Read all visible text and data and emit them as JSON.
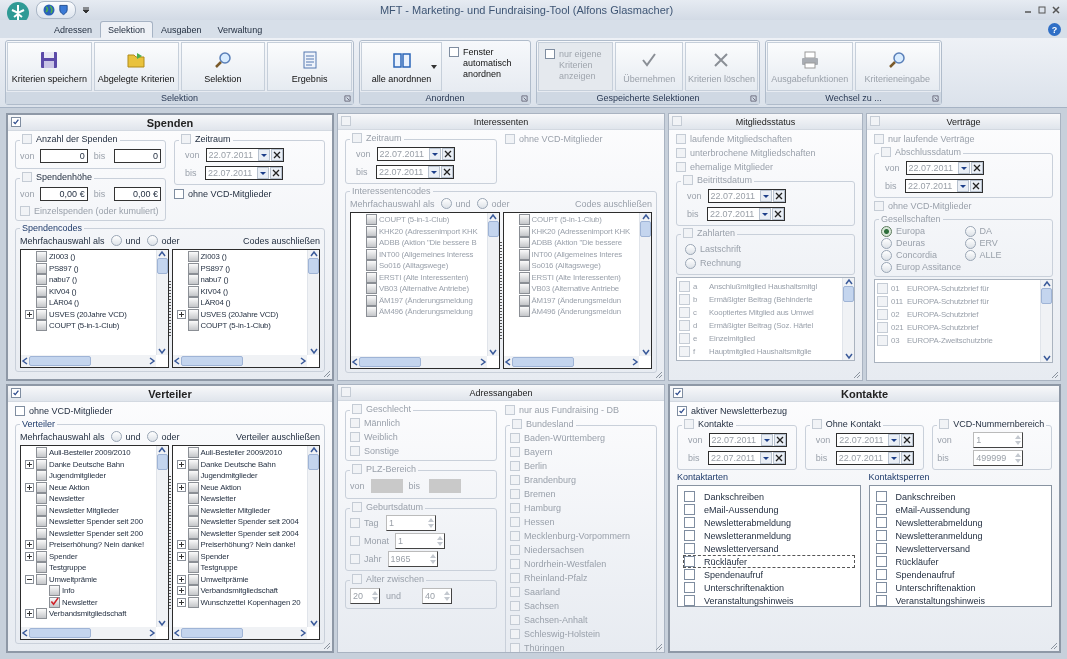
{
  "window": {
    "title": "MFT -  Marketing- und Fundraising-Tool (Alfons Glasmacher)"
  },
  "ribbon": {
    "help": "?",
    "tabs": [
      {
        "label": "Adressen",
        "selected": false
      },
      {
        "label": "Selektion",
        "selected": true
      },
      {
        "label": "Ausgaben",
        "selected": false
      },
      {
        "label": "Verwaltung",
        "selected": false
      }
    ],
    "groups": [
      {
        "title": "Selektion",
        "items": [
          {
            "kind": "button",
            "label": "Kriterien speichern",
            "disabled": false
          },
          {
            "kind": "button",
            "label": "Abgelegte Kriterien",
            "disabled": false
          },
          {
            "kind": "button",
            "label": "Selektion",
            "disabled": false
          },
          {
            "kind": "button",
            "label": "Ergebnis",
            "disabled": false
          }
        ]
      },
      {
        "title": "Anordnen",
        "items": [
          {
            "kind": "button",
            "label": "alle anordnnen",
            "disabled": false,
            "dropdown": true
          },
          {
            "kind": "check",
            "label": "Fenster automatisch anordnen",
            "checked": false,
            "disabled": false
          }
        ]
      },
      {
        "title": "Gespeicherte Selektionen",
        "items": [
          {
            "kind": "check",
            "label": "nur eigene Kriterien anzeigen",
            "checked": false,
            "disabled": true
          },
          {
            "kind": "button",
            "label": "Übernehmen",
            "disabled": true
          },
          {
            "kind": "button",
            "label": "Kriterien löschen",
            "disabled": true
          }
        ]
      },
      {
        "title": "Wechsel zu ...",
        "items": [
          {
            "kind": "button",
            "label": "Ausgabefunktionen",
            "disabled": true
          },
          {
            "kind": "button",
            "label": "Kriterieneingabe",
            "disabled": true
          }
        ]
      }
    ]
  },
  "panels": [
    {
      "title": "Spenden",
      "checked": true,
      "body": [
        {
          "kind": "row",
          "children": [
            {
              "kind": "col",
              "children": [
                {
                  "kind": "group",
                  "title": "Anzahl der Spenden",
                  "checked": false,
                  "children": [
                    {
                      "kind": "fields",
                      "items": [
                        {
                          "label": "von",
                          "value": "0"
                        },
                        {
                          "label": "bis",
                          "value": "0"
                        }
                      ]
                    }
                  ]
                },
                {
                  "kind": "group",
                  "title": "Spendenhöhe",
                  "checked": false,
                  "children": [
                    {
                      "kind": "fields",
                      "items": [
                        {
                          "label": "von",
                          "value": "0,00 €"
                        },
                        {
                          "label": "bis",
                          "value": "0,00 €"
                        }
                      ]
                    },
                    {
                      "kind": "check",
                      "label": "Einzelspenden (oder kumuliert)",
                      "checked": false
                    }
                  ]
                }
              ]
            },
            {
              "kind": "col",
              "children": [
                {
                  "kind": "group",
                  "title": "Zeitraum",
                  "checked": false,
                  "children": [
                    {
                      "kind": "date",
                      "label": "von",
                      "value": "22.07.2011"
                    },
                    {
                      "kind": "date",
                      "label": "bis",
                      "value": "22.07.2011"
                    }
                  ]
                },
                {
                  "kind": "check",
                  "label": "ohne VCD-Mitglieder",
                  "checked": false
                }
              ]
            }
          ]
        },
        {
          "kind": "group",
          "title": "Spendencodes",
          "children": [
            {
              "kind": "choice",
              "label": "Mehrfachauswahl als",
              "options": [
                {
                  "label": "und",
                  "selected": false
                },
                {
                  "label": "oder",
                  "selected": false
                }
              ],
              "note": "Codes auschließen"
            },
            {
              "kind": "trees",
              "trees": [
                [
                  {
                    "label": "ZI003 ()",
                    "checked": false
                  },
                  {
                    "label": "PS897 ()",
                    "checked": false
                  },
                  {
                    "label": "nabu7 ()",
                    "checked": false
                  },
                  {
                    "label": "KIV04 ()",
                    "checked": false
                  },
                  {
                    "label": "LÄR04 ()",
                    "checked": false
                  },
                  {
                    "label": "USVES (20Jahre VCD)",
                    "checked": false,
                    "expanded": false
                  },
                  {
                    "label": "COUPT (5-in-1-Club)",
                    "checked": false
                  }
                ],
                [
                  {
                    "label": "ZI003 ()",
                    "checked": false
                  },
                  {
                    "label": "PS897 ()",
                    "checked": false
                  },
                  {
                    "label": "nabu7 ()",
                    "checked": false
                  },
                  {
                    "label": "KIV04 ()",
                    "checked": false
                  },
                  {
                    "label": "LÄR04 ()",
                    "checked": false
                  },
                  {
                    "label": "USVES (20Jahre VCD)",
                    "checked": false,
                    "expanded": false
                  },
                  {
                    "label": "COUPT (5-in-1-Club)",
                    "checked": false
                  }
                ]
              ]
            }
          ]
        }
      ]
    },
    {
      "title": "Interessenten",
      "checked": false,
      "body": [
        {
          "kind": "row",
          "children": [
            {
              "kind": "col",
              "children": [
                {
                  "kind": "group",
                  "title": "Zeitraum",
                  "checked": false,
                  "children": [
                    {
                      "kind": "date",
                      "label": "von",
                      "value": "22.07.2011"
                    },
                    {
                      "kind": "date",
                      "label": "bis",
                      "value": "22.07.2011"
                    }
                  ]
                }
              ]
            },
            {
              "kind": "col",
              "children": [
                {
                  "kind": "check",
                  "label": "ohne VCD-Mitglieder",
                  "checked": false
                }
              ]
            }
          ]
        },
        {
          "kind": "group",
          "title": "Interessentencodes",
          "children": [
            {
              "kind": "choice",
              "label": "Mehrfachauswahl als",
              "options": [
                {
                  "label": "und",
                  "selected": false
                },
                {
                  "label": "oder",
                  "selected": false
                }
              ],
              "note": "Codes auschließen"
            },
            {
              "kind": "trees",
              "trees": [
                [
                  {
                    "label": "COUPT (5-in-1-Club)",
                    "checked": false
                  },
                  {
                    "label": "KHK20 (Adressenimport KHK",
                    "checked": false
                  },
                  {
                    "label": "ADBB (Aktion \"Die bessere B",
                    "checked": false
                  },
                  {
                    "label": "INT00 (Allgemeines Interess",
                    "checked": false
                  },
                  {
                    "label": "So016 (Alltagswege)",
                    "checked": false
                  },
                  {
                    "label": "ERSTI (Alte Interessenten)",
                    "checked": false
                  },
                  {
                    "label": "VB03 (Alternative Antriebe)",
                    "checked": false
                  },
                  {
                    "label": "ÄM197 (Änderungsmeldung",
                    "checked": false
                  },
                  {
                    "label": "ÄM496 (Änderungsmeldung",
                    "checked": false
                  }
                ],
                [
                  {
                    "label": "COUPT (5-in-1-Club)",
                    "checked": false
                  },
                  {
                    "label": "KHK20 (Adressenimport KHK",
                    "checked": false
                  },
                  {
                    "label": "ADBB (Aktion \"Die bessere",
                    "checked": false
                  },
                  {
                    "label": "INT00 (Allgemeines Interes",
                    "checked": false
                  },
                  {
                    "label": "So016 (Alltagswege)",
                    "checked": false
                  },
                  {
                    "label": "ERSTI (Alte Interessenten)",
                    "checked": false
                  },
                  {
                    "label": "VB03 (Alternative Antriebe",
                    "checked": false
                  },
                  {
                    "label": "ÄM197 (Änderungsmeldun",
                    "checked": false
                  },
                  {
                    "label": "ÄM496 (Änderungsmeldun",
                    "checked": false
                  }
                ]
              ]
            }
          ]
        }
      ]
    },
    {
      "title": "Mitgliedsstatus",
      "checked": false,
      "body": [
        {
          "kind": "check",
          "label": "laufende Mitgliedschaften",
          "checked": false
        },
        {
          "kind": "check",
          "label": "unterbrochene Mitgliedschaften",
          "checked": false
        },
        {
          "kind": "check",
          "label": "ehemalige Mitglieder",
          "checked": false
        },
        {
          "kind": "group",
          "title": "Beitrittsdatum",
          "checked": false,
          "children": [
            {
              "kind": "date",
              "label": "von",
              "value": "22.07.2011"
            },
            {
              "kind": "date",
              "label": "bis",
              "value": "22.07.2011"
            }
          ]
        },
        {
          "kind": "group",
          "title": "Zahlarten",
          "checked": false,
          "children": [
            {
              "kind": "radiolist",
              "options": [
                {
                  "label": "Lastschrift",
                  "selected": false
                },
                {
                  "label": "Rechnung",
                  "selected": false
                }
              ]
            }
          ]
        },
        {
          "kind": "codelist",
          "rows": [
            {
              "code": "a",
              "text": "Anschlußmitglied Haushaltsmitgl",
              "checked": false
            },
            {
              "code": "b",
              "text": "Ermäßigter Beitrag (Behinderte",
              "checked": false
            },
            {
              "code": "c",
              "text": "Kooptiertes Mitglied aus Umwel",
              "checked": false
            },
            {
              "code": "d",
              "text": "Ermäßigter Beitrag (Soz. Härtel",
              "checked": false
            },
            {
              "code": "e",
              "text": "Einzelmitglied",
              "checked": false
            },
            {
              "code": "f",
              "text": "Hauptmitglied Haushaltsmitglie",
              "checked": false
            }
          ]
        }
      ]
    },
    {
      "title": "Verträge",
      "checked": false,
      "body": [
        {
          "kind": "check",
          "label": "nur laufende Verträge",
          "checked": false
        },
        {
          "kind": "group",
          "title": "Abschlussdatum",
          "checked": false,
          "children": [
            {
              "kind": "date",
              "label": "von",
              "value": "22.07.2011"
            },
            {
              "kind": "date",
              "label": "bis",
              "value": "22.07.2011"
            }
          ]
        },
        {
          "kind": "check",
          "label": "ohne VCD-Mitglieder",
          "checked": false
        },
        {
          "kind": "group",
          "title": "Gesellschaften",
          "children": [
            {
              "kind": "radiogrid",
              "options": [
                {
                  "label": "Europa",
                  "selected": true
                },
                {
                  "label": "DA",
                  "selected": false
                },
                {
                  "label": "Deuras",
                  "selected": false
                },
                {
                  "label": "ERV",
                  "selected": false
                },
                {
                  "label": "Concordia",
                  "selected": false
                },
                {
                  "label": "ALLE",
                  "selected": false
                },
                {
                  "label": "Europ Assitance",
                  "selected": false
                }
              ]
            }
          ]
        },
        {
          "kind": "codelist",
          "rows": [
            {
              "code": "01",
              "text": "EUROPA-Schutzbrief für",
              "checked": false
            },
            {
              "code": "011",
              "text": "EUROPA-Schutzbrief für",
              "checked": false
            },
            {
              "code": "02",
              "text": "EUROPA-Schutzbrief",
              "checked": false
            },
            {
              "code": "021",
              "text": "EUROPA-Schutzbrief",
              "checked": false
            },
            {
              "code": "03",
              "text": "EUROPA-Zweitschutzbrie",
              "checked": false
            }
          ]
        }
      ]
    },
    {
      "title": "Verteiler",
      "checked": true,
      "body": [
        {
          "kind": "check",
          "label": "ohne VCD-Mitglieder",
          "checked": false
        },
        {
          "kind": "group",
          "title": "Verteiler",
          "children": [
            {
              "kind": "choice",
              "label": "Mehrfachauswahl als",
              "options": [
                {
                  "label": "und",
                  "selected": false
                },
                {
                  "label": "oder",
                  "selected": false
                }
              ],
              "note": "Verteiler auschließen"
            },
            {
              "kind": "trees",
              "trees": [
                [
                  {
                    "label": "Auli-Besteller 2009/2010",
                    "checked": false
                  },
                  {
                    "label": "Danke Deutsche Bahn",
                    "checked": false,
                    "expanded": false
                  },
                  {
                    "label": "Jugendmitglieder",
                    "checked": false
                  },
                  {
                    "label": "Neue Aktion",
                    "checked": false,
                    "expanded": false
                  },
                  {
                    "label": "Newsletter",
                    "checked": false
                  },
                  {
                    "label": "Newsletter Mitglieder",
                    "checked": false
                  },
                  {
                    "label": "Newsletter Spender seit 200",
                    "checked": false
                  },
                  {
                    "label": "Newsletter Spender seit 200",
                    "checked": false
                  },
                  {
                    "label": "Preiserhöhung? Nein danke!",
                    "checked": false,
                    "expanded": false
                  },
                  {
                    "label": "Spender",
                    "checked": false,
                    "expanded": false
                  },
                  {
                    "label": "Testgruppe",
                    "checked": false
                  },
                  {
                    "label": "Umweltprämie",
                    "checked": false,
                    "expanded": true,
                    "children": [
                      {
                        "label": "Info",
                        "checked": false
                      },
                      {
                        "label": "Newsletter",
                        "checked": true
                      }
                    ]
                  },
                  {
                    "label": "Verbandsmitgliedschaft",
                    "checked": false,
                    "expanded": false
                  }
                ],
                [
                  {
                    "label": "Auli-Besteller 2009/2010",
                    "checked": false
                  },
                  {
                    "label": "Danke Deutsche Bahn",
                    "checked": false,
                    "expanded": false
                  },
                  {
                    "label": "Jugendmitglieder",
                    "checked": false
                  },
                  {
                    "label": "Neue Aktion",
                    "checked": false,
                    "expanded": false
                  },
                  {
                    "label": "Newsletter",
                    "checked": false
                  },
                  {
                    "label": "Newsletter Mitglieder",
                    "checked": false
                  },
                  {
                    "label": "Newsletter Spender seit 2004",
                    "checked": false
                  },
                  {
                    "label": "Newsletter Spender seit 2004",
                    "checked": false
                  },
                  {
                    "label": "Preiserhöhung? Nein danke!",
                    "checked": false,
                    "expanded": false
                  },
                  {
                    "label": "Spender",
                    "checked": false,
                    "expanded": false
                  },
                  {
                    "label": "Testgruppe",
                    "checked": false
                  },
                  {
                    "label": "Umweltprämie",
                    "checked": false,
                    "expanded": false
                  },
                  {
                    "label": "Verbandsmitgliedschaft",
                    "checked": false,
                    "expanded": false
                  },
                  {
                    "label": "Wunschzettel Kopenhagen 20",
                    "checked": false,
                    "expanded": false
                  }
                ]
              ]
            }
          ]
        }
      ]
    },
    {
      "title": "Adressangaben",
      "checked": false,
      "body": [
        {
          "kind": "row",
          "children": [
            {
              "kind": "col",
              "children": [
                {
                  "kind": "group",
                  "title": "Geschlecht",
                  "checked": false,
                  "children": [
                    {
                      "kind": "check",
                      "label": "Männlich",
                      "checked": false
                    },
                    {
                      "kind": "check",
                      "label": "Weiblich",
                      "checked": false
                    },
                    {
                      "kind": "check",
                      "label": "Sonstige",
                      "checked": false
                    }
                  ]
                },
                {
                  "kind": "group",
                  "title": "PLZ-Bereich",
                  "checked": false,
                  "children": [
                    {
                      "kind": "fields",
                      "items": [
                        {
                          "label": "von"
                        },
                        {
                          "label": "bis"
                        }
                      ]
                    }
                  ]
                },
                {
                  "kind": "group",
                  "title": "Geburtsdatum",
                  "checked": false,
                  "children": [
                    {
                      "kind": "spins",
                      "items": [
                        {
                          "label": "Tag",
                          "checked": false,
                          "value": "1"
                        },
                        {
                          "label": "Monat",
                          "checked": false,
                          "value": "1"
                        },
                        {
                          "label": "Jahr",
                          "checked": false,
                          "value": "1965"
                        }
                      ]
                    }
                  ]
                },
                {
                  "kind": "group",
                  "title": "Alter zwischen",
                  "checked": false,
                  "children": [
                    {
                      "kind": "spinline",
                      "items": [
                        {
                          "value": "20"
                        },
                        {
                          "label": "und",
                          "value": "40"
                        }
                      ]
                    }
                  ]
                }
              ]
            },
            {
              "kind": "col",
              "children": [
                {
                  "kind": "check",
                  "label": "nur aus Fundraising - DB",
                  "checked": false
                },
                {
                  "kind": "group",
                  "title": "Bundesland",
                  "checked": false,
                  "children": [
                    {
                      "kind": "check",
                      "label": "Baden-Württemberg",
                      "checked": false
                    },
                    {
                      "kind": "check",
                      "label": "Bayern",
                      "checked": false
                    },
                    {
                      "kind": "check",
                      "label": "Berlin",
                      "checked": false
                    },
                    {
                      "kind": "check",
                      "label": "Brandenburg",
                      "checked": false
                    },
                    {
                      "kind": "check",
                      "label": "Bremen",
                      "checked": false
                    },
                    {
                      "kind": "check",
                      "label": "Hamburg",
                      "checked": false
                    },
                    {
                      "kind": "check",
                      "label": "Hessen",
                      "checked": false
                    },
                    {
                      "kind": "check",
                      "label": "Mecklenburg-Vorpommern",
                      "checked": false
                    },
                    {
                      "kind": "check",
                      "label": "Niedersachsen",
                      "checked": false
                    },
                    {
                      "kind": "check",
                      "label": "Nordrhein-Westfalen",
                      "checked": false
                    },
                    {
                      "kind": "check",
                      "label": "Rheinland-Pfalz",
                      "checked": false
                    },
                    {
                      "kind": "check",
                      "label": "Saarland",
                      "checked": false
                    },
                    {
                      "kind": "check",
                      "label": "Sachsen",
                      "checked": false
                    },
                    {
                      "kind": "check",
                      "label": "Sachsen-Anhalt",
                      "checked": false
                    },
                    {
                      "kind": "check",
                      "label": "Schleswig-Holstein",
                      "checked": false
                    },
                    {
                      "kind": "check",
                      "label": "Thüringen",
                      "checked": false
                    }
                  ]
                }
              ]
            }
          ]
        }
      ]
    },
    {
      "title": "Kontakte",
      "checked": true,
      "body": [
        {
          "kind": "check",
          "label": "aktiver Newsletterbezug",
          "checked": true
        },
        {
          "kind": "row",
          "children": [
            {
              "kind": "col",
              "children": [
                {
                  "kind": "group",
                  "title": "Kontakte",
                  "checked": false,
                  "children": [
                    {
                      "kind": "date",
                      "label": "von",
                      "value": "22.07.2011"
                    },
                    {
                      "kind": "date",
                      "label": "bis",
                      "value": "22.07.2011"
                    }
                  ]
                }
              ]
            },
            {
              "kind": "col",
              "children": [
                {
                  "kind": "group",
                  "title": "Ohne Kontakt",
                  "checked": false,
                  "children": [
                    {
                      "kind": "date",
                      "label": "von",
                      "value": "22.07.2011"
                    },
                    {
                      "kind": "date",
                      "label": "bis",
                      "value": "22.07.2011"
                    }
                  ]
                }
              ]
            },
            {
              "kind": "col",
              "children": [
                {
                  "kind": "group",
                  "title": "VCD-Nummernbereich",
                  "checked": false,
                  "children": [
                    {
                      "kind": "spins",
                      "items": [
                        {
                          "label": "von",
                          "value": "1"
                        },
                        {
                          "label": "bis",
                          "value": "499999"
                        }
                      ]
                    }
                  ]
                }
              ]
            }
          ]
        },
        {
          "kind": "row",
          "children": [
            {
              "kind": "col",
              "children": [
                {
                  "kind": "checklist",
                  "title": "Kontaktarten",
                  "items": [
                    {
                      "label": "Dankschreiben",
                      "checked": false,
                      "focused": false
                    },
                    {
                      "label": "eMail-Aussendung",
                      "checked": false,
                      "focused": false
                    },
                    {
                      "label": "Newsletterabmeldung",
                      "checked": false,
                      "focused": false
                    },
                    {
                      "label": "Newsletteranmeldung",
                      "checked": false,
                      "focused": false
                    },
                    {
                      "label": "Newsletterversand",
                      "checked": false,
                      "focused": false
                    },
                    {
                      "label": "Rückläufer",
                      "checked": false,
                      "focused": true
                    },
                    {
                      "label": "Spendenaufruf",
                      "checked": false,
                      "focused": false
                    },
                    {
                      "label": "Unterschriftenaktion",
                      "checked": false,
                      "focused": false
                    },
                    {
                      "label": "Veranstaltungshinweis",
                      "checked": false,
                      "focused": false
                    }
                  ]
                }
              ]
            },
            {
              "kind": "col",
              "children": [
                {
                  "kind": "checklist",
                  "title": "Kontaktsperren",
                  "items": [
                    {
                      "label": "Dankschreiben",
                      "checked": false
                    },
                    {
                      "label": "eMail-Aussendung",
                      "checked": false
                    },
                    {
                      "label": "Newsletterabmeldung",
                      "checked": false
                    },
                    {
                      "label": "Newsletteranmeldung",
                      "checked": false
                    },
                    {
                      "label": "Newsletterversand",
                      "checked": false
                    },
                    {
                      "label": "Rückläufer",
                      "checked": false
                    },
                    {
                      "label": "Spendenaufruf",
                      "checked": false
                    },
                    {
                      "label": "Unterschriftenaktion",
                      "checked": false
                    },
                    {
                      "label": "Veranstaltungshinweis",
                      "checked": false
                    }
                  ]
                }
              ]
            }
          ]
        }
      ]
    }
  ]
}
